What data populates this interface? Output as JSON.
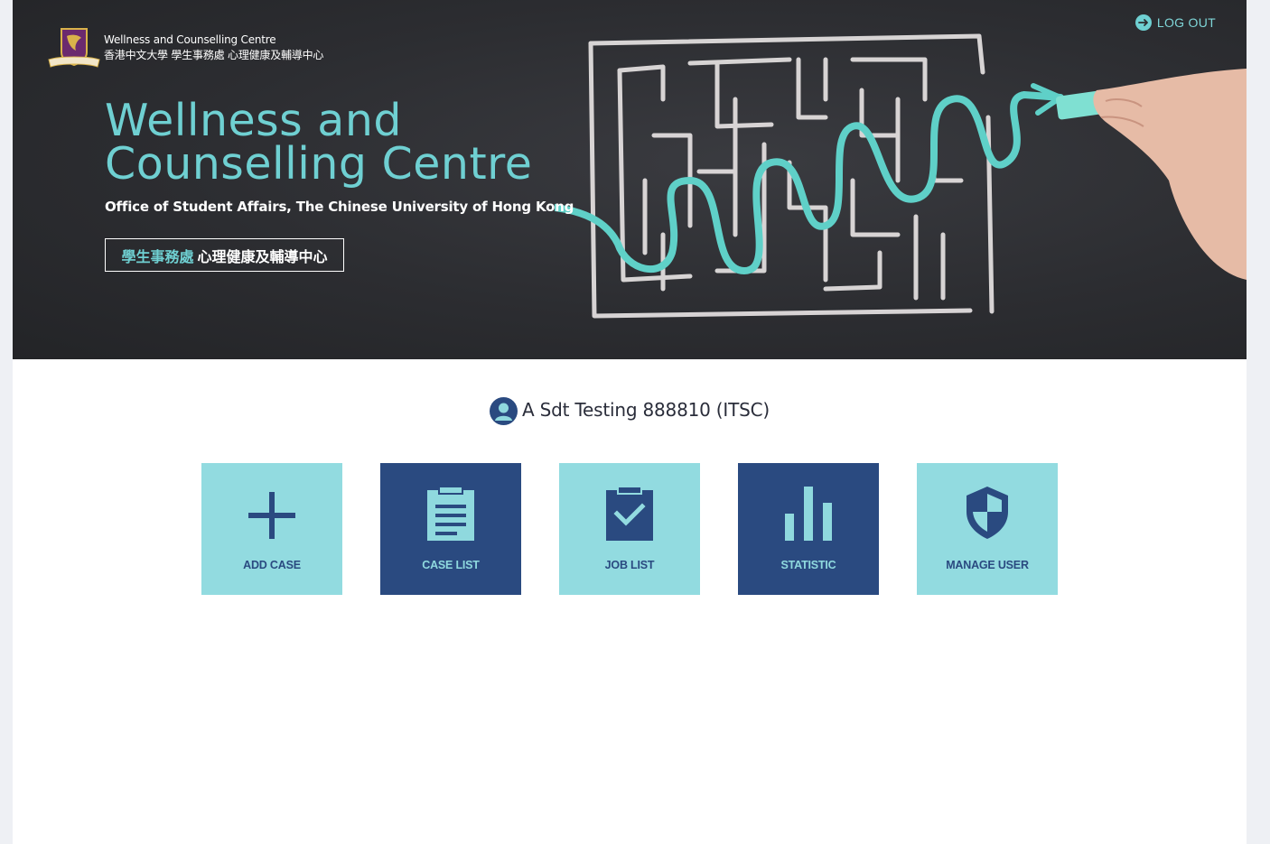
{
  "header": {
    "brand_line1": "Wellness and Counselling Centre",
    "brand_line2": "香港中文大學 學生事務處 心理健康及輔導中心",
    "logout_label": "LOG OUT",
    "title": "Wellness and Counselling Centre",
    "subtitle": "Office of Student Affairs, The Chinese University of Hong Kong",
    "chinese_part1": "學生事務處",
    "chinese_part2": "心理健康及輔導中心"
  },
  "user": {
    "name": "A Sdt Testing 888810 (ITSC)",
    "icon": "user-avatar-icon"
  },
  "tiles": [
    {
      "label": "ADD CASE",
      "icon": "plus-icon",
      "style": "light"
    },
    {
      "label": "CASE LIST",
      "icon": "clipboard-list-icon",
      "style": "dark"
    },
    {
      "label": "JOB LIST",
      "icon": "clipboard-check-icon",
      "style": "light"
    },
    {
      "label": "STATISTIC",
      "icon": "bar-chart-icon",
      "style": "dark"
    },
    {
      "label": "MANAGE USER",
      "icon": "shield-icon",
      "style": "light"
    }
  ],
  "colors": {
    "accent_teal": "#6fd0d2",
    "tile_light": "#92dbe0",
    "tile_dark": "#2a4a80",
    "hero_bg": "#2c2d31"
  }
}
